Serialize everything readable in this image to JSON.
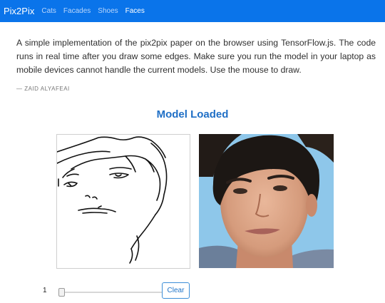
{
  "nav": {
    "brand": "Pix2Pix",
    "links": [
      "Cats",
      "Facades",
      "Shoes",
      "Faces"
    ],
    "active": "Faces"
  },
  "intro": {
    "text": "A simple implementation of the pix2pix paper on the browser using TensorFlow.js. The code runs in real time after you draw some edges. Make sure you run the model in your laptop as mobile devices cannot handle the current models. Use the mouse to draw.",
    "author": "— ZAID ALYAFEAI"
  },
  "status": "Model Loaded",
  "controls": {
    "slider_value": "1",
    "clear_label": "Clear"
  },
  "colors": {
    "navbar": "#0a74ea",
    "accent": "#1f6fc6",
    "output_background": "#8ec7ea"
  }
}
